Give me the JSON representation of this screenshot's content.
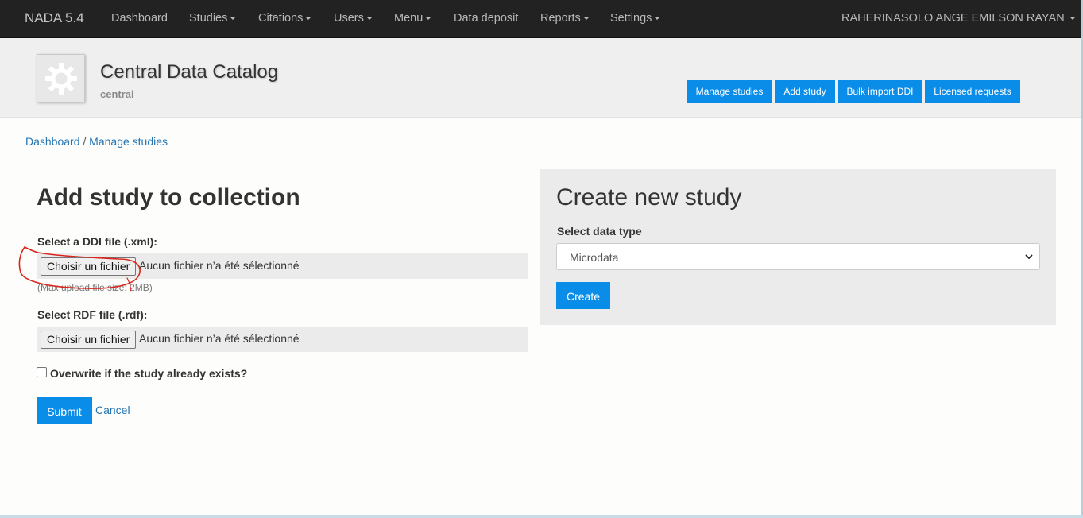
{
  "navbar": {
    "brand": "NADA 5.4",
    "items": [
      {
        "label": "Dashboard",
        "dropdown": false
      },
      {
        "label": "Studies",
        "dropdown": true
      },
      {
        "label": "Citations",
        "dropdown": true
      },
      {
        "label": "Users",
        "dropdown": true
      },
      {
        "label": "Menu",
        "dropdown": true
      },
      {
        "label": "Data deposit",
        "dropdown": false
      },
      {
        "label": "Reports",
        "dropdown": true
      },
      {
        "label": "Settings",
        "dropdown": true
      }
    ],
    "user": "RAHERINASOLO ANGE EMILSON RAYAN"
  },
  "catalog": {
    "title": "Central Data Catalog",
    "subtitle": "central",
    "logo_icon": "gear-icon",
    "buttons": [
      "Manage studies",
      "Add study",
      "Bulk import DDI",
      "Licensed requests"
    ]
  },
  "breadcrumb": {
    "items": [
      "Dashboard",
      "Manage studies"
    ],
    "separator": "/"
  },
  "add_form": {
    "title": "Add study to collection",
    "ddi_label": "Select a DDI file (.xml):",
    "ddi_button": "Choisir un fichier",
    "ddi_status": "Aucun fichier n’a été sélectionné",
    "upload_hint": "(Max upload file size: 2MB)",
    "rdf_label": "Select RDF file (.rdf):",
    "rdf_button": "Choisir un fichier",
    "rdf_status": "Aucun fichier n’a été sélectionné",
    "overwrite_label": "Overwrite if the study already exists?",
    "overwrite_checked": false,
    "submit": "Submit",
    "cancel": "Cancel"
  },
  "create_panel": {
    "title": "Create new study",
    "data_type_label": "Select data type",
    "data_type_value": "Microdata",
    "create_button": "Create"
  },
  "colors": {
    "navbar": "#222222",
    "accent": "#0a8ce9",
    "link": "#2475b3",
    "annotation": "#d9251c"
  }
}
